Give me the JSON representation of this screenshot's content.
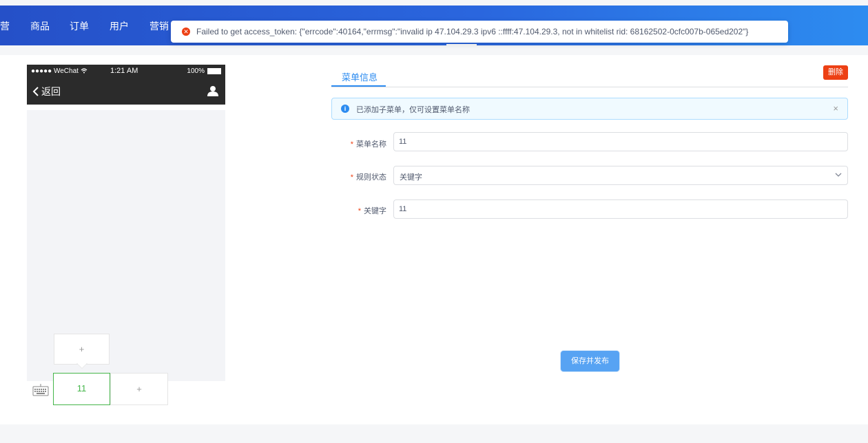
{
  "nav": {
    "items": [
      {
        "label": "营"
      },
      {
        "label": "商品"
      },
      {
        "label": "订单"
      },
      {
        "label": "用户"
      },
      {
        "label": "营销"
      }
    ]
  },
  "toast": {
    "message": "Failed to get access_token: {\"errcode\":40164,\"errmsg\":\"invalid ip 47.104.29.3 ipv6 ::ffff:47.104.29.3, not in whitelist rid: 68162502-0cfc007b-065ed202\"}",
    "type_icon": "error-icon",
    "icon_glyph": "✕",
    "color": "#ed4014"
  },
  "phone": {
    "status": {
      "carrier": "●●●●● WeChat",
      "time": "1:21 AM",
      "battery": "100%"
    },
    "back_label": "返回",
    "menu": {
      "sub_button_label": "+",
      "main_buttons": [
        {
          "label": "11",
          "active": true
        },
        {
          "label": "+",
          "active": false
        }
      ]
    }
  },
  "panel": {
    "tab_label": "菜单信息",
    "delete_label": "删除",
    "alert": {
      "text": "已添加子菜单，仅可设置菜单名称",
      "icon_glyph": "i",
      "close_glyph": "×"
    },
    "form": {
      "required_mark": "*",
      "name_label": "菜单名称",
      "name_value": "11",
      "rule_label": "规则状态",
      "rule_value": "关键字",
      "keyword_label": "关键字",
      "keyword_value": "11"
    },
    "save_label": "保存并发布"
  },
  "colors": {
    "accent": "#2d8cf0",
    "danger": "#ed4014",
    "menu_active": "#44b549"
  }
}
